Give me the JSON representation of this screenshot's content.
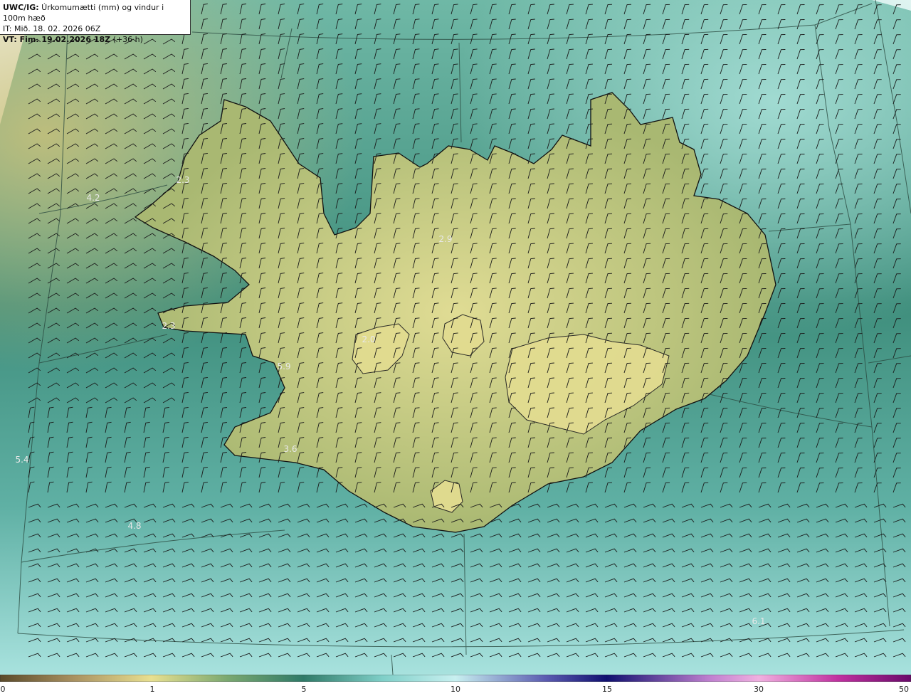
{
  "header": {
    "line1_bold": "UWC/IG:",
    "line1_rest": " Úrkomumætti (mm) og vindur i 100m hæð",
    "line2": "IT: Mið. 18. 02. 2026 06Z",
    "line3_bold": "VT: Fim. 19.02.2026 18Z",
    "line3_rest": " (+36 h)"
  },
  "map_labels": [
    "4.2",
    "2.3",
    "2.9",
    "2.3",
    "2.0",
    "5.9",
    "5.4",
    "3.6",
    "4.8",
    "6.1"
  ],
  "colorbar": {
    "ticks": [
      "0",
      "1",
      "5",
      "10",
      "15",
      "30",
      "50"
    ],
    "colors": [
      "#5a4a2a",
      "#b0a060",
      "#e8e090",
      "#6aa070",
      "#2f7a68",
      "#7fcfc8",
      "#c8f0f0",
      "#3030a0",
      "#101070",
      "#e0a0e0",
      "#a02090",
      "#6a0a6a"
    ]
  },
  "map_colors": {
    "sea": "#3f8e7c",
    "sea_light": "#8fd0c8",
    "land": "#a6b870",
    "land_high": "#d8d890",
    "outline": "#111111"
  }
}
